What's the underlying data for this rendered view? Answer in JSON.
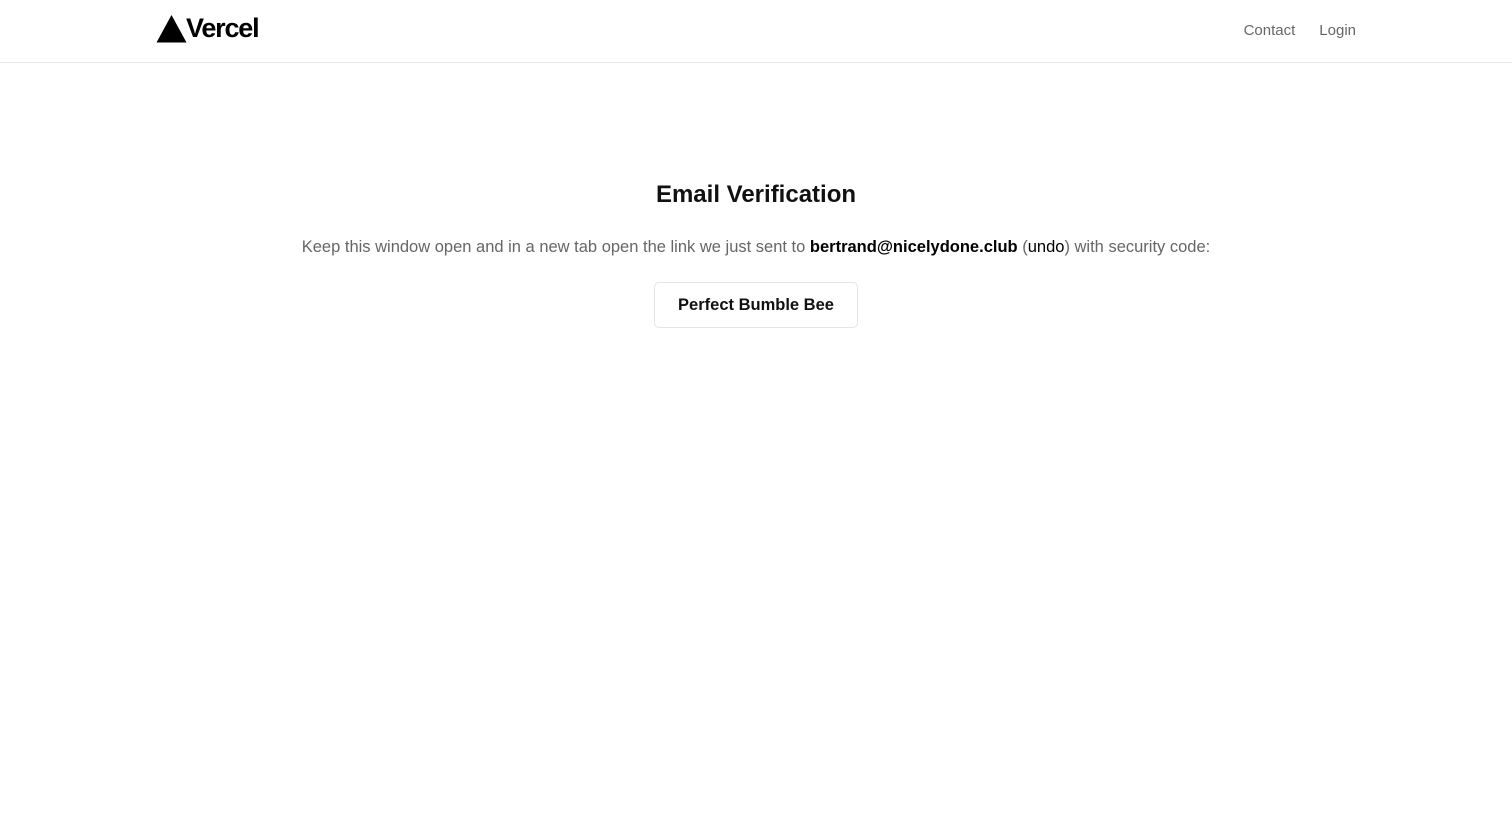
{
  "header": {
    "brand": "Vercel",
    "logo_icon": "triangle-icon",
    "nav": {
      "contact": "Contact",
      "login": "Login"
    }
  },
  "verification": {
    "title": "Email Verification",
    "message_before": "Keep this window open and in a new tab open the link we just sent to ",
    "email": "bertrand@nicelydone.club",
    "paren_open": " (",
    "undo_label": "undo",
    "message_after": ") with security code:",
    "security_code": "Perfect Bumble Bee"
  },
  "colors": {
    "background": "#ffffff",
    "text_primary": "#111111",
    "text_secondary": "#666666",
    "border": "#eaeaea"
  }
}
